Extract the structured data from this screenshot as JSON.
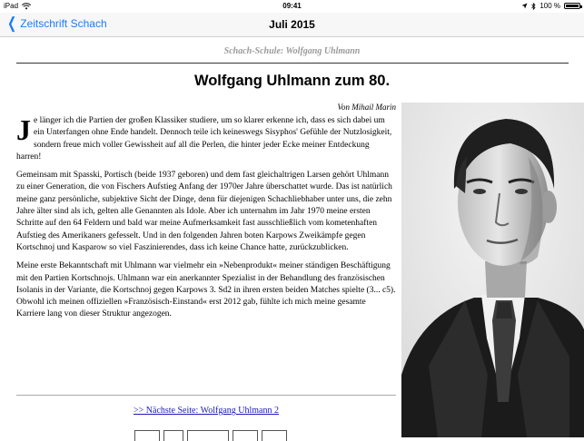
{
  "status_bar": {
    "carrier": "iPad",
    "time": "09:41",
    "battery_text": "100 %",
    "battery_level": 1.0
  },
  "nav": {
    "back_label": "Zeitschrift Schach",
    "title": "Juli 2015",
    "accent": "#1a7cf5"
  },
  "article": {
    "kicker": "Schach-Schule: Wolfgang Uhlmann",
    "title": "Wolfgang Uhlmann zum 80.",
    "byline": "Von Mihail Marin",
    "drop_cap": "J",
    "paragraph1_rest": "e länger ich die Partien der großen Klassiker studiere, um so klarer erkenne ich, dass es sich dabei um ein Unterfangen ohne Ende handelt. Dennoch teile ich keineswegs Sisyphos' Gefühle der Nutzlosigkeit, sondern freue mich voller Gewissheit auf all die Perlen, die hinter jeder Ecke meiner Entdeckung harren!",
    "paragraph2": "Gemeinsam mit Spasski, Portisch (beide 1937 geboren) und dem fast gleichaltrigen Larsen gehört Uhlmann zu einer Generation, die von Fischers Aufstieg Anfang der 1970er Jahre überschattet wurde. Das ist natürlich meine ganz persönliche, subjektive Sicht der Dinge, denn für diejenigen Schachliebhaber unter uns, die zehn Jahre älter sind als ich, gelten alle Genannten als Idole. Aber ich unternahm im Jahr 1970 meine ersten Schritte auf den 64 Feldern und bald war meine Aufmerksamkeit fast ausschließlich vom kometenhaften Aufstieg des Amerikaners gefesselt. Und in den folgenden Jahren boten Karpows Zweikämpfe gegen Kortschnoj und Kasparow so viel Faszinierendes, dass ich keine Chance hatte, zurückzublicken.",
    "paragraph3": "Meine erste Bekanntschaft mit Uhlmann war vielmehr ein »Nebenprodukt« meiner ständigen Beschäftigung mit den Partien Kortschnojs. Uhlmann war ein anerkannter Spezialist in der Behandlung des französischen Isolanis in der Variante, die Kortschnoj gegen Karpows 3. Sd2 in ihren ersten beiden Matches spielte (3... c5). Obwohl ich meinen offiziellen »Französisch-Einstand« erst 2012 gab, fühlte ich mich meine gesamte Karriere lang von dieser Struktur angezogen.",
    "next_link": ">> Nächste Seite: Wolfgang Uhlmann 2",
    "link_color": "#1a1ab8"
  }
}
